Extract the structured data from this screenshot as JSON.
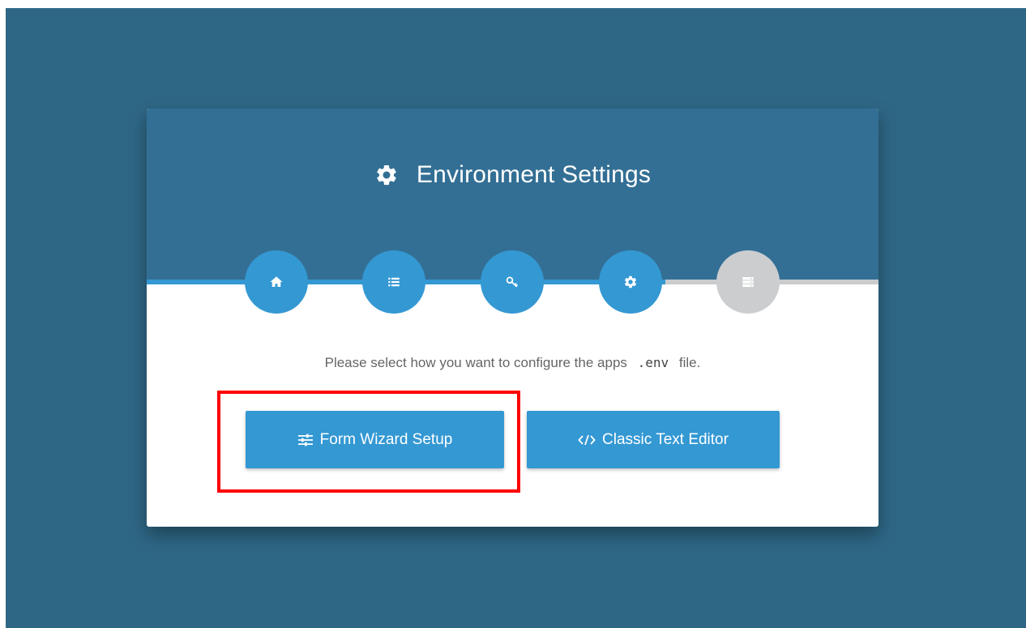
{
  "page": {
    "title": "Environment Settings",
    "title_icon": "gear-icon"
  },
  "steps": [
    {
      "icon": "home-icon",
      "state": "complete"
    },
    {
      "icon": "list-icon",
      "state": "complete"
    },
    {
      "icon": "key-icon",
      "state": "complete"
    },
    {
      "icon": "gear-icon",
      "state": "complete"
    },
    {
      "icon": "server-icon",
      "state": "pending"
    }
  ],
  "prompt": {
    "before": "Please select how you want to configure the apps",
    "code": ".env",
    "after": "file."
  },
  "buttons": {
    "wizard_label": "Form Wizard Setup",
    "wizard_icon": "sliders-icon",
    "editor_label": "Classic Text Editor",
    "editor_icon": "code-icon"
  },
  "colors": {
    "background": "#2e6785",
    "header": "#336f94",
    "accent": "#3498d3",
    "inactive": "#cbcdcf",
    "highlight": "#ff0000"
  }
}
